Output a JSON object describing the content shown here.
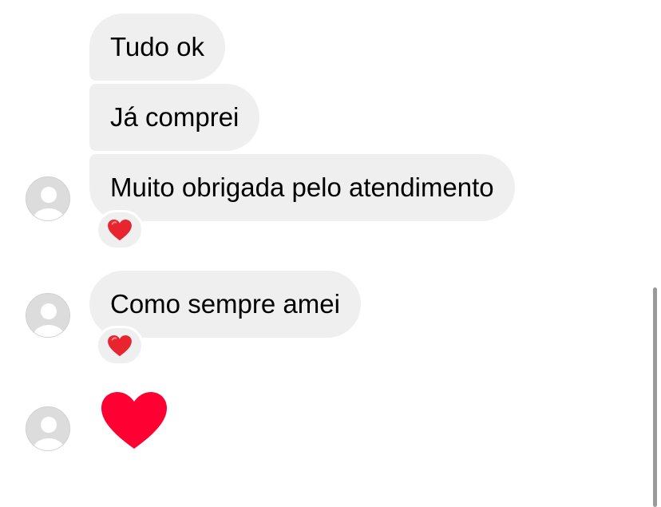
{
  "messages": [
    {
      "text": "Tudo ok"
    },
    {
      "text": "Já comprei"
    },
    {
      "text": "Muito obrigada pelo atendimento",
      "reaction_icon": "red-heart-reaction-icon"
    },
    {
      "text": "Como sempre amei",
      "reaction_icon": "red-heart-reaction-icon"
    },
    {
      "big_emoji_icon": "large-red-heart-icon"
    }
  ],
  "colors": {
    "bubble_bg": "#efefef",
    "text": "#000000",
    "heart": "#ff0033",
    "avatar": "#dcdcdc",
    "scrollbar": "#9a9a9a"
  }
}
